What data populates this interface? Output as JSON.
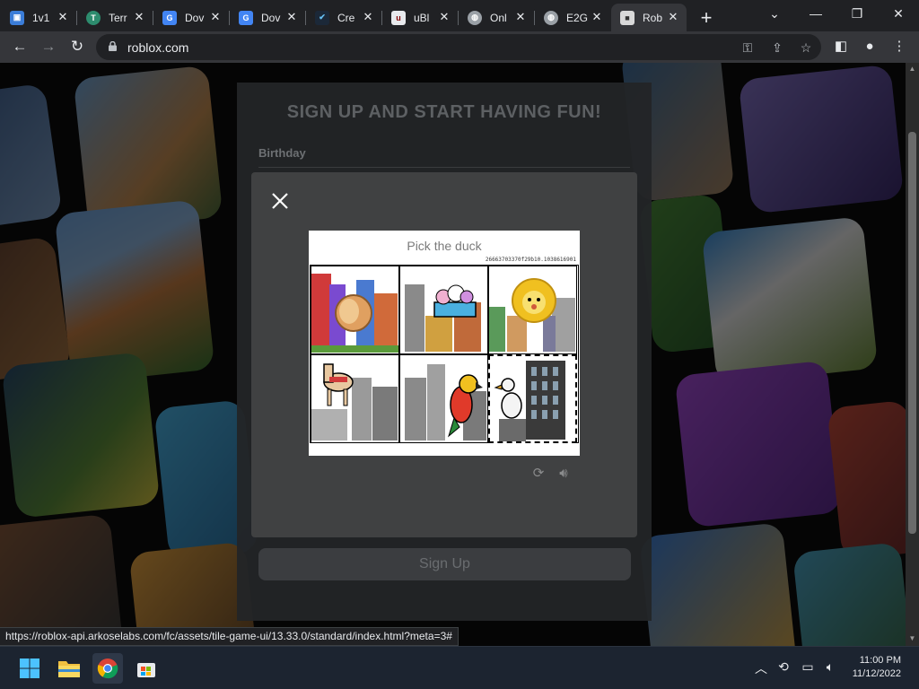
{
  "browser": {
    "tabs": [
      {
        "label": "1v1",
        "icon": "game-favicon",
        "color": "#3b7dd8"
      },
      {
        "label": "Terr",
        "icon": "terraria-favicon",
        "color": "#2d8c6e"
      },
      {
        "label": "Dov",
        "icon": "google-docs-favicon",
        "color": "#4285f4"
      },
      {
        "label": "Dov",
        "icon": "google-docs-favicon",
        "color": "#4285f4"
      },
      {
        "label": "Cre",
        "icon": "steam-favicon",
        "color": "#1b2838"
      },
      {
        "label": "uBl",
        "icon": "ublock-favicon",
        "color": "#800000"
      },
      {
        "label": "Onl",
        "icon": "globe-favicon",
        "color": "#5f6368"
      },
      {
        "label": "E2G",
        "icon": "globe-favicon",
        "color": "#5f6368"
      },
      {
        "label": "Rob",
        "icon": "roblox-favicon",
        "color": "#d9d9d9",
        "active": true
      }
    ],
    "url": "roblox.com",
    "status_url": "https://roblox-api.arkoselabs.com/fc/assets/tile-game-ui/13.33.0/standard/index.html?meta=3#"
  },
  "signup": {
    "heading": "SIGN UP AND START HAVING FUN!",
    "birthday_label": "Birthday",
    "submit_label": "Sign Up"
  },
  "captcha": {
    "prompt": "Pick the duck",
    "token": "26663703370f29b10.1038616901",
    "tiles": [
      {
        "subject": "bread-on-city-buildings",
        "selected": false
      },
      {
        "subject": "ice-cream-on-city-buildings",
        "selected": false
      },
      {
        "subject": "lion-on-city-buildings",
        "selected": false
      },
      {
        "subject": "horse-on-city-buildings",
        "selected": false
      },
      {
        "subject": "parrot-on-city-buildings",
        "selected": false
      },
      {
        "subject": "duck-on-city-buildings",
        "selected": true
      }
    ]
  },
  "taskbar": {
    "apps": [
      "start-icon",
      "file-explorer-icon",
      "chrome-icon",
      "store-icon"
    ],
    "time": "11:00 PM",
    "date": "11/12/2022"
  },
  "colors": {
    "tab_bar": "#202124",
    "toolbar": "#35363a",
    "modal": "#404142",
    "captcha_bg": "#ffffff"
  }
}
